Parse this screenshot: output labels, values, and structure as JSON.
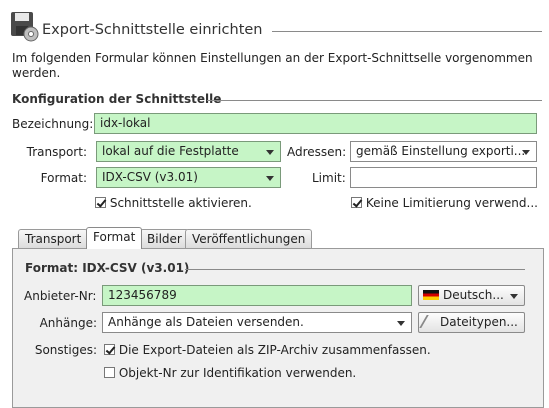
{
  "header": {
    "title": "Export-Schnittstelle einrichten",
    "intro": "Im folgenden Formular können Einstellungen an der Export-Schnittselle vorgenommen werden.",
    "icon": "disk-gear-icon"
  },
  "config": {
    "section_title": "Konfiguration der Schnittstelle",
    "bezeichnung_label": "Bezeichnung:",
    "bezeichnung_value": "idx-lokal",
    "transport_label": "Transport:",
    "transport_value": "lokal auf die Festplatte",
    "adressen_label": "Adressen:",
    "adressen_value": "gemäß Einstellung exporti...",
    "format_label": "Format:",
    "format_value": "IDX-CSV (v3.01)",
    "limit_label": "Limit:",
    "limit_value": "",
    "activate_label": "Schnittstelle aktivieren.",
    "activate_checked": true,
    "nolimit_label": "Keine Limitierung verwend...",
    "nolimit_checked": true
  },
  "tabs": [
    "Transport",
    "Format",
    "Bilder",
    "Veröffentlichungen"
  ],
  "active_tab": "Format",
  "format_panel": {
    "section_title": "Format: IDX-CSV (v3.01)",
    "anbieter_label": "Anbieter-Nr:",
    "anbieter_value": "123456789",
    "language_value": "Deutsch...",
    "anhaenge_label": "Anhänge:",
    "anhaenge_value": "Anhänge als Dateien versenden.",
    "dateitypen_label": "Dateitypen...",
    "sonstiges_label": "Sonstiges:",
    "zip_label": "Die Export-Dateien als ZIP-Archiv zusammenfassen.",
    "zip_checked": true,
    "objekt_label": "Objekt-Nr zur Identifikation verwenden.",
    "objekt_checked": false
  },
  "colors": {
    "field_green": "#c6f5c6"
  }
}
